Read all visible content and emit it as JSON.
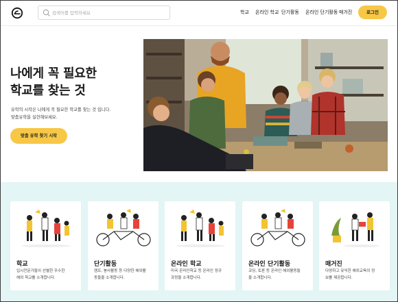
{
  "colors": {
    "accent": "#f7c746",
    "band": "#e3f5f4"
  },
  "header": {
    "logo_icon": "brand-logo-icon",
    "search_placeholder": "검색어를 입력하세요",
    "nav": [
      "학교",
      "온라인 학교",
      "단기활동",
      "온라인 단기활동",
      "매거진"
    ],
    "login_label": "로그인"
  },
  "hero": {
    "title_line1": "나에게 꼭 필요한",
    "title_line2": "학교를 찾는 것",
    "desc_line1": "유학의 시작은 나에게 꼭 필요한 학교를 찾는 것 입니다.",
    "desc_line2": "맞춤유학을 실현해보세요.",
    "cta_label": "맞춤 유학 찾기 시작"
  },
  "cards": [
    {
      "title": "학교",
      "desc_line1": "입시전문가들이 선별한 우수한",
      "desc_line2": "해외 학교를 소개합니다."
    },
    {
      "title": "단기활동",
      "desc_line1": "캠프, 봉사활동 등 다양한 해외활",
      "desc_line2": "동들을 소개합니다."
    },
    {
      "title": "온라인 학교",
      "desc_line1": "미국 온라인학교 등 온라인 정규",
      "desc_line2": "과정을 소개합니다."
    },
    {
      "title": "온라인 단기활동",
      "desc_line1": "코딩, 토론 등 온라인 해외활동들",
      "desc_line2": "을 소개합니다."
    },
    {
      "title": "매거진",
      "desc_line1": "다양하고 유익한 해외교육의 정",
      "desc_line2": "보를 제공합니다."
    }
  ]
}
